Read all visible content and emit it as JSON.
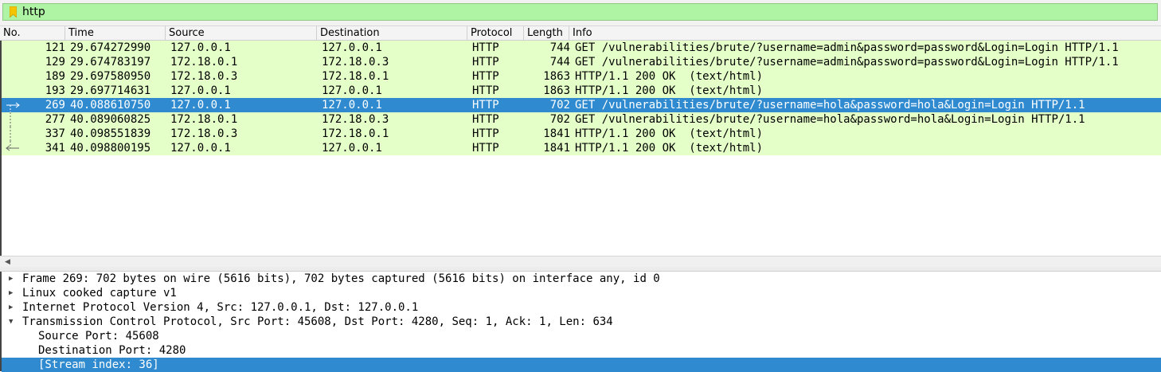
{
  "filter": {
    "value": "http",
    "accent": "#aff4a4"
  },
  "columns": [
    "No.",
    "Time",
    "Source",
    "Destination",
    "Protocol",
    "Length",
    "Info"
  ],
  "packets": [
    {
      "no": "121",
      "time": "29.674272990",
      "src": "127.0.0.1",
      "dst": "127.0.0.1",
      "proto": "HTTP",
      "len": "744",
      "info": "GET /vulnerabilities/brute/?username=admin&password=password&Login=Login HTTP/1.1"
    },
    {
      "no": "129",
      "time": "29.674783197",
      "src": "172.18.0.1",
      "dst": "172.18.0.3",
      "proto": "HTTP",
      "len": "744",
      "info": "GET /vulnerabilities/brute/?username=admin&password=password&Login=Login HTTP/1.1"
    },
    {
      "no": "189",
      "time": "29.697580950",
      "src": "172.18.0.3",
      "dst": "172.18.0.1",
      "proto": "HTTP",
      "len": "1863",
      "info": "HTTP/1.1 200 OK  (text/html)"
    },
    {
      "no": "193",
      "time": "29.697714631",
      "src": "127.0.0.1",
      "dst": "127.0.0.1",
      "proto": "HTTP",
      "len": "1863",
      "info": "HTTP/1.1 200 OK  (text/html)"
    },
    {
      "no": "269",
      "time": "40.088610750",
      "src": "127.0.0.1",
      "dst": "127.0.0.1",
      "proto": "HTTP",
      "len": "702",
      "info": "GET /vulnerabilities/brute/?username=hola&password=hola&Login=Login HTTP/1.1"
    },
    {
      "no": "277",
      "time": "40.089060825",
      "src": "172.18.0.1",
      "dst": "172.18.0.3",
      "proto": "HTTP",
      "len": "702",
      "info": "GET /vulnerabilities/brute/?username=hola&password=hola&Login=Login HTTP/1.1"
    },
    {
      "no": "337",
      "time": "40.098551839",
      "src": "172.18.0.3",
      "dst": "172.18.0.1",
      "proto": "HTTP",
      "len": "1841",
      "info": "HTTP/1.1 200 OK  (text/html)"
    },
    {
      "no": "341",
      "time": "40.098800195",
      "src": "127.0.0.1",
      "dst": "127.0.0.1",
      "proto": "HTTP",
      "len": "1841",
      "info": "HTTP/1.1 200 OK  (text/html)"
    }
  ],
  "selected_packet": "269",
  "colors": {
    "row_bg": "#e4ffc7",
    "selection": "#2f8ad0"
  },
  "details": [
    {
      "text": "Frame 269: 702 bytes on wire (5616 bits), 702 bytes captured (5616 bits) on interface any, id 0",
      "expander": "collapsed"
    },
    {
      "text": "Linux cooked capture v1",
      "expander": "collapsed"
    },
    {
      "text": "Internet Protocol Version 4, Src: 127.0.0.1, Dst: 127.0.0.1",
      "expander": "collapsed"
    },
    {
      "text": "Transmission Control Protocol, Src Port: 45608, Dst Port: 4280, Seq: 1, Ack: 1, Len: 634",
      "expander": "expanded"
    },
    {
      "text": "Source Port: 45608",
      "expander": "none"
    },
    {
      "text": "Destination Port: 4280",
      "expander": "none"
    },
    {
      "text": "[Stream index: 36]",
      "expander": "none",
      "selected": true
    }
  ]
}
